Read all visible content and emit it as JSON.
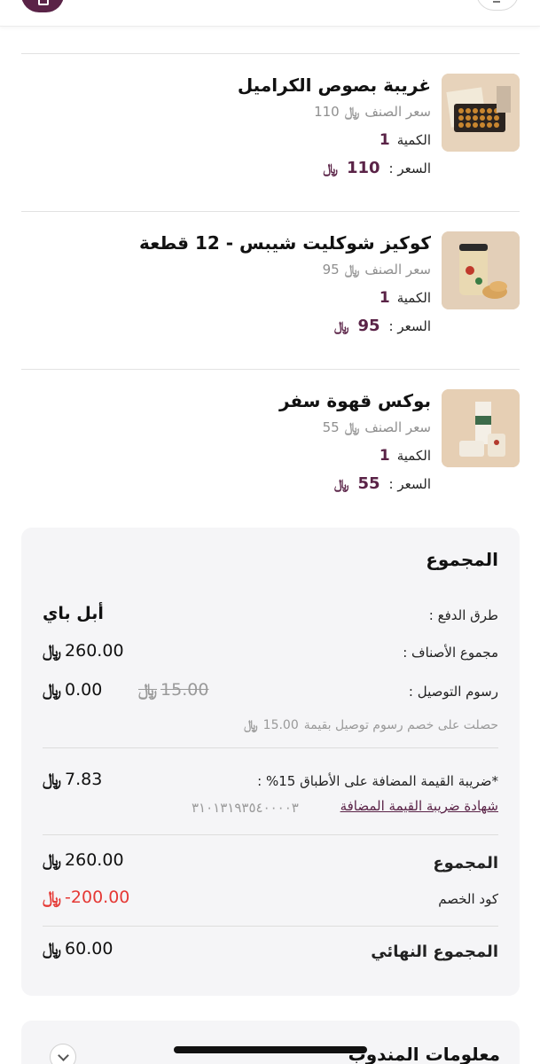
{
  "currency_symbol": "﷼",
  "products": [
    {
      "name": "غريبة بصوص الكراميل",
      "unit_price_value": "110",
      "unit_price_label": "سعر الصنف",
      "qty_label": "الكمية",
      "qty": "1",
      "price_label": "السعر :",
      "price": "110"
    },
    {
      "name": "كوكيز شوكليت شيبس - 12 قطعة",
      "unit_price_value": "95",
      "unit_price_label": "سعر الصنف",
      "qty_label": "الكمية",
      "qty": "1",
      "price_label": "السعر :",
      "price": "95"
    },
    {
      "name": "بوكس قهوة سفر",
      "unit_price_value": "55",
      "unit_price_label": "سعر الصنف",
      "qty_label": "الكمية",
      "qty": "1",
      "price_label": "السعر :",
      "price": "55"
    }
  ],
  "summary": {
    "title": "المجموع",
    "payment_label": "طرق الدفع :",
    "payment_value": "أبل باي",
    "items_total_label": "مجموع الأصناف :",
    "items_total_value": "260.00",
    "delivery_label": "رسوم التوصيل :",
    "delivery_value": "0.00",
    "delivery_original": "15.00",
    "delivery_note": "حصلت على خصم رسوم توصيل بقيمة",
    "delivery_note_value": "15.00",
    "vat_label": "*ضريبة القيمة المضافة على الأطباق 15% :",
    "vat_value": "7.83",
    "vat_certificate_label": "شهادة ضريبة القيمة المضافة",
    "vat_number": "٣١٠١٣١٩٣٥٤٠٠٠٠٣",
    "total_label": "المجموع",
    "total_value": "260.00",
    "discount_label": "كود الخصم",
    "discount_value": "200.00-",
    "final_label": "المجموع النهائي",
    "final_value": "60.00"
  },
  "agent_section": {
    "title": "معلومات المندوب"
  },
  "colors": {
    "brand": "#5a2347",
    "discount_red": "#e53935",
    "muted": "#9a9a9a",
    "card_bg": "#f5f5f7"
  },
  "icons": {
    "top_left": "bag-icon",
    "top_right": "minus-icon",
    "chevron": "chevron-down-icon",
    "currency": "riyal-icon"
  }
}
